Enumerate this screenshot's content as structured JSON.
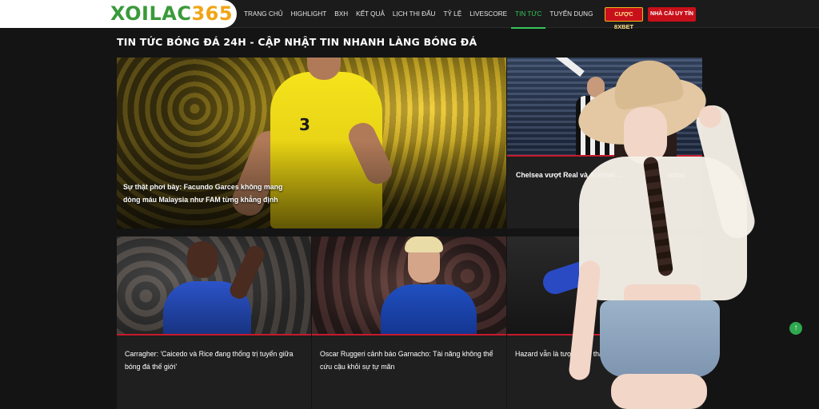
{
  "logo": {
    "part1": "XOILAC",
    "part2": "365"
  },
  "nav": {
    "items": [
      "TRANG CHỦ",
      "HIGHLIGHT",
      "BXH",
      "KẾT QUẢ",
      "LỊCH THI ĐẤU",
      "TỶ LỆ",
      "LIVESCORE",
      "TIN TỨC",
      "TUYỂN DỤNG"
    ],
    "active": "TIN TỨC"
  },
  "buttons": {
    "cuoc": "CƯỢC 8XBET",
    "nhacai": "NHÀ CÁI UY TÍN"
  },
  "section": {
    "title": "TIN TỨC BÓNG ĐÁ 24H - CẬP NHẬT TIN NHANH LÀNG BÓNG ĐÁ"
  },
  "articles": [
    {
      "headline": "Sự thật phơi bày: Facundo Garces không mang dòng máu Malaysia như FAM từng khẳng định"
    },
    {
      "headline": "Chelsea vượt Real và Arsenal ... Yildiz từ Juventus"
    },
    {
      "headline": "Carragher: 'Caicedo và Rice đang thống trị tuyến giữa bóng đá thế giới'"
    },
    {
      "headline": "Oscar Ruggeri cảnh báo Garnacho: Tài năng không thể cứu cậu khỏi sự tự mãn"
    },
    {
      "headline": "Hazard vẫn là tượng đ... thách thức kỷ lục"
    }
  ],
  "player_number": "3",
  "scroll_top_icon": "arrow-up-icon",
  "colors": {
    "accent_green": "#34c759",
    "brand_red": "#c8101a",
    "logo_orange": "#f0a516"
  }
}
